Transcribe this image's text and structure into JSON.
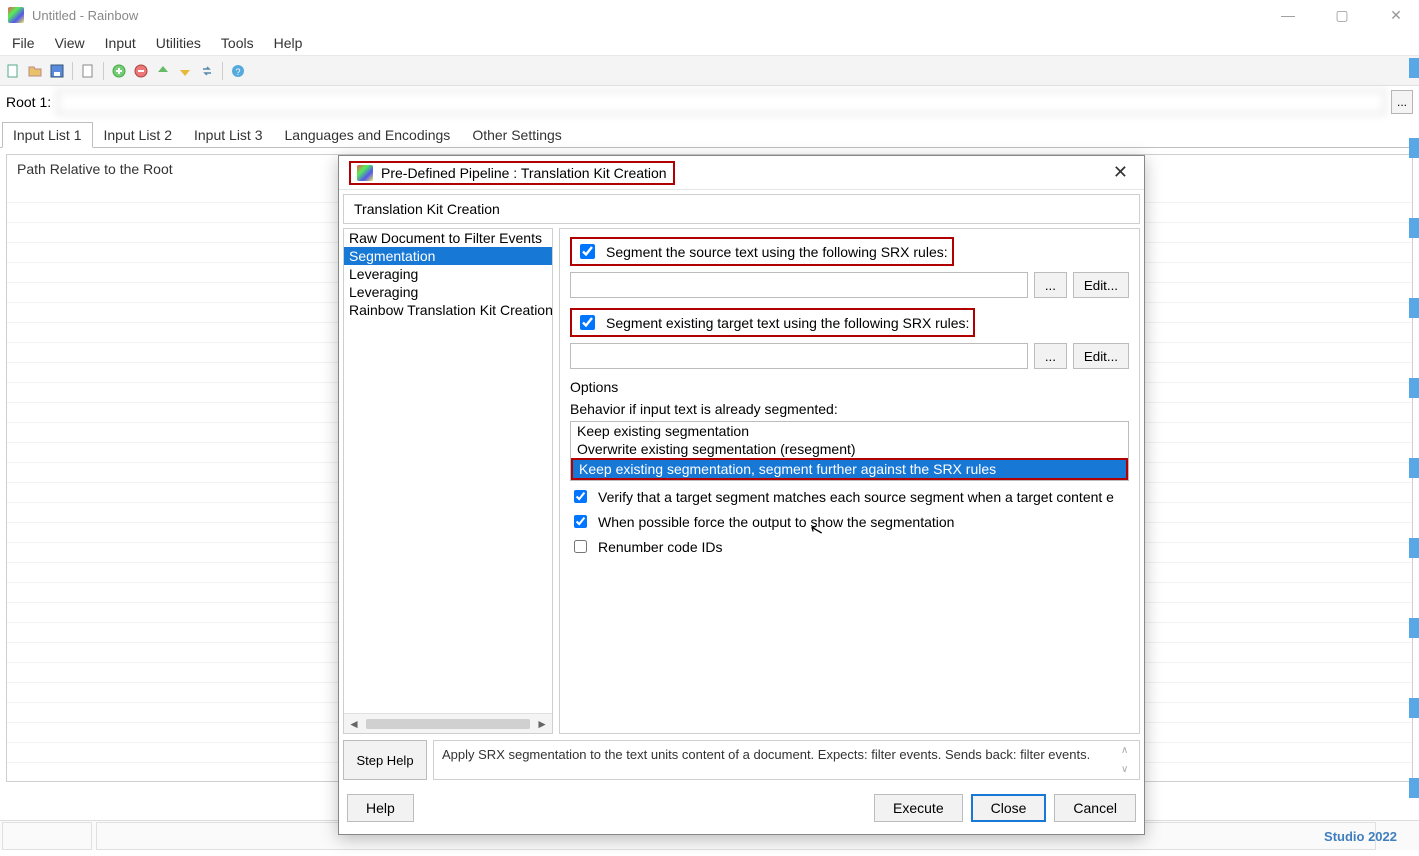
{
  "window": {
    "title": "Untitled - Rainbow"
  },
  "menu": {
    "items": [
      "File",
      "View",
      "Input",
      "Utilities",
      "Tools",
      "Help"
    ]
  },
  "root": {
    "label": "Root 1:",
    "value": "",
    "browse": "..."
  },
  "tabs": {
    "items": [
      "Input List 1",
      "Input List 2",
      "Input List 3",
      "Languages and Encodings",
      "Other Settings"
    ],
    "active_index": 0
  },
  "list": {
    "header": "Path Relative to the Root"
  },
  "dialog": {
    "title": "Pre-Defined Pipeline : Translation Kit Creation",
    "section_title": "Translation Kit Creation",
    "steps": [
      "Raw Document to Filter Events",
      "Segmentation",
      "Leveraging",
      "Leveraging",
      "Rainbow Translation Kit Creation"
    ],
    "selected_step_index": 1,
    "right": {
      "seg_source_label": "Segment the source text using the following SRX rules:",
      "seg_source_checked": true,
      "seg_source_path": "",
      "seg_target_label": "Segment existing target text using the following SRX rules:",
      "seg_target_checked": true,
      "seg_target_path": "",
      "browse": "...",
      "edit": "Edit...",
      "options_label": "Options",
      "behavior_label": "Behavior if input text is already segmented:",
      "behavior_options": [
        "Keep existing segmentation",
        "Overwrite existing segmentation (resegment)",
        "Keep existing segmentation, segment further against the SRX rules"
      ],
      "behavior_selected_index": 2,
      "verify_label": "Verify that a target segment matches each source segment when a target content e",
      "verify_checked": true,
      "force_label": "When possible force the output to show the segmentation",
      "force_checked": true,
      "renumber_label": "Renumber code IDs",
      "renumber_checked": false
    },
    "step_help_button": "Step Help",
    "step_desc": "Apply SRX segmentation to the text units content of a document. Expects: filter events. Sends back: filter events.",
    "buttons": {
      "help": "Help",
      "execute": "Execute",
      "close": "Close",
      "cancel": "Cancel"
    }
  },
  "background": {
    "studio_text": "Studio 2022"
  }
}
